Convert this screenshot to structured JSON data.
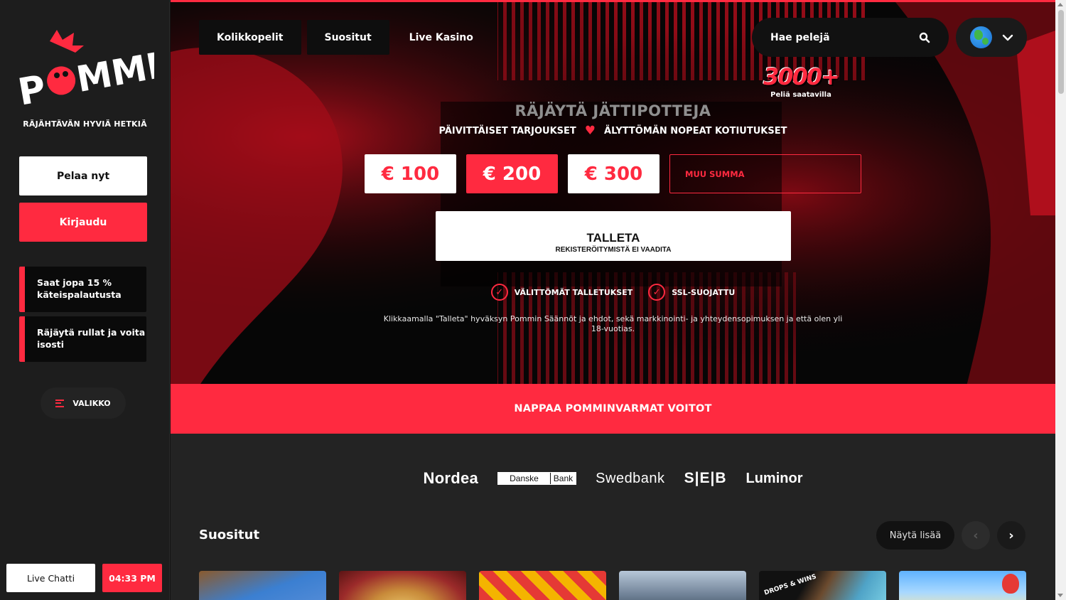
{
  "brand": {
    "logo_text": "POMMI",
    "tagline": "RÄJÄHTÄVÄN HYVIÄ HETKIÄ",
    "accent_color": "#ff2a40"
  },
  "sidebar": {
    "play_button": "Pelaa nyt",
    "login_button": "Kirjaudu",
    "promos": [
      {
        "text": "Saat jopa 15 % käteispalautusta"
      },
      {
        "text": "Räjäytä rullat ja voita isosti"
      }
    ],
    "menu_label": "VALIKKO",
    "menu_icon": "hamburger-icon",
    "live_chat": "Live Chatti",
    "clock": "04:33 PM"
  },
  "topnav": {
    "tabs": [
      {
        "label": "Kolikkopelit"
      },
      {
        "label": "Suositut"
      },
      {
        "label": "Live Kasino"
      }
    ],
    "search_placeholder": "Hae pelejä",
    "search_icon": "search-icon",
    "language_icon": "globe-icon"
  },
  "hero": {
    "games_count": "3000+",
    "games_count_label": "Peliä saatavilla",
    "title": "RÄJÄYTÄ JÄTTIPOTTEJA",
    "sub_left": "PÄIVITTÄISET TARJOUKSET",
    "sub_right": "ÄLYTTÖMÄN NOPEAT KOTIUTUKSET",
    "amounts": [
      "€ 100",
      "€ 200",
      "€ 300"
    ],
    "selected_amount": "€ 200",
    "custom_amount_placeholder": "MUU SUMMA",
    "deposit_label": "TALLETA",
    "deposit_sublabel": "REKISTERÖITYMISTÄ EI VAADITA",
    "checks": [
      "VÄLITTÖMÄT TALLETUKSET",
      "SSL-SUOJATTU"
    ],
    "terms": "Klikkaamalla \"Talleta\" hyväksyn Pommin Säännöt ja ehdot, sekä markkinointi- ja yhteydensopimuksen ja että olen yli 18-vuotias."
  },
  "banner": {
    "text": "NAPPAA POMMINVARMAT VOITOT"
  },
  "banks": {
    "nordea": "Nordea",
    "danske_left": "Danske",
    "danske_right": "Bank",
    "swedbank": "Swedbank",
    "seb": "S|E|B",
    "luminor": "Luminor"
  },
  "popular": {
    "title": "Suositut",
    "show_more": "Näytä lisää",
    "game_tag": "DROPS & WINS"
  }
}
